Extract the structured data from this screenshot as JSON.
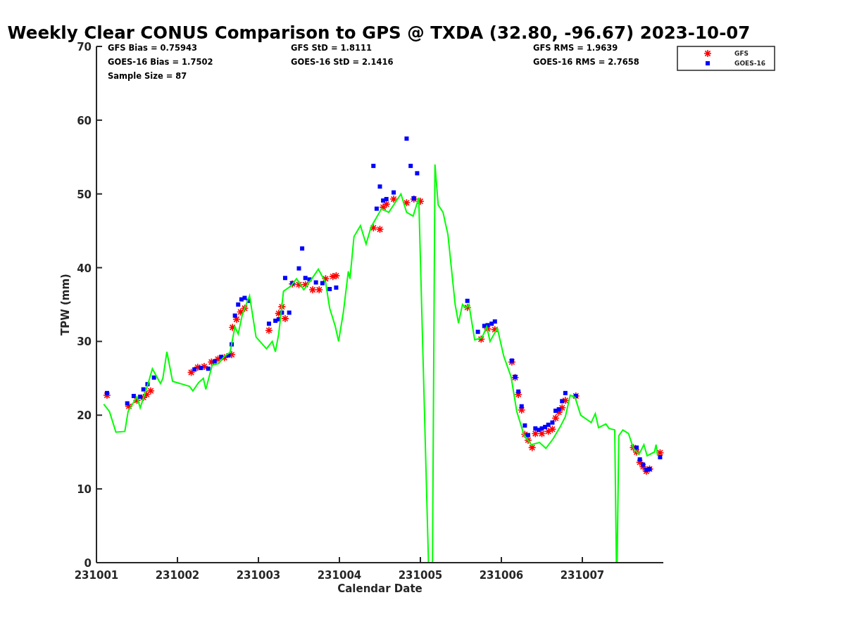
{
  "title": "Weekly Clear CONUS Comparison to GPS @ TXDA (32.80, -96.67) 2023-10-07",
  "stats": [
    [
      "GFS Bias = 0.75943",
      "GFS StD = 1.8111",
      "GFS RMS = 1.9639"
    ],
    [
      "GOES-16 Bias = 1.7502",
      "GOES-16 StD = 2.1416",
      "GOES-16 RMS = 2.7658"
    ],
    [
      "Sample Size = 87"
    ]
  ],
  "chart_data": {
    "type": "scatter",
    "xlabel": "Calendar Date",
    "ylabel": "TPW (mm)",
    "xlim": [
      231001,
      231008
    ],
    "ylim": [
      0,
      70
    ],
    "xticks": [
      231001,
      231002,
      231003,
      231004,
      231005,
      231006,
      231007
    ],
    "yticks": [
      0,
      10,
      20,
      30,
      40,
      50,
      60,
      70
    ],
    "series": [
      {
        "name": "GFS",
        "marker": "cross",
        "color": "#ff0000",
        "x": [
          231001.13,
          231001.4,
          231001.5,
          231001.58,
          231001.62,
          231001.67,
          231002.17,
          231002.25,
          231002.33,
          231002.42,
          231002.5,
          231002.58,
          231002.67,
          231002.68,
          231002.73,
          231002.78,
          231002.83,
          231003.13,
          231003.25,
          231003.29,
          231003.33,
          231003.42,
          231003.5,
          231003.58,
          231003.67,
          231003.75,
          231003.83,
          231003.92,
          231003.96,
          231004.42,
          231004.5,
          231004.54,
          231004.58,
          231004.67,
          231004.83,
          231004.92,
          231005,
          231005.58,
          231005.75,
          231005.83,
          231005.92,
          231006.13,
          231006.17,
          231006.21,
          231006.25,
          231006.29,
          231006.33,
          231006.38,
          231006.42,
          231006.5,
          231006.58,
          231006.63,
          231006.67,
          231006.71,
          231006.75,
          231006.79,
          231006.92,
          231007.63,
          231007.67,
          231007.71,
          231007.75,
          231007.79,
          231007.83,
          231007.96
        ],
        "values": [
          22.7,
          21.2,
          22.0,
          22.4,
          22.8,
          23.3,
          25.8,
          26.5,
          26.6,
          27.2,
          27.6,
          27.8,
          28.2,
          31.9,
          33.0,
          34.0,
          34.5,
          31.5,
          33.8,
          34.7,
          33.1,
          37.8,
          37.7,
          37.7,
          37.0,
          37.0,
          38.5,
          38.8,
          38.9,
          45.4,
          45.2,
          48.2,
          48.6,
          49.3,
          48.8,
          49.3,
          49.0,
          34.6,
          30.3,
          31.7,
          31.6,
          27.2,
          25.1,
          22.8,
          20.7,
          17.4,
          16.6,
          15.6,
          17.5,
          17.5,
          17.8,
          18.1,
          19.6,
          20.4,
          21.0,
          22.0,
          22.6,
          15.6,
          15.0,
          13.6,
          13.0,
          12.4,
          12.7,
          14.9
        ]
      },
      {
        "name": "GOES-16",
        "marker": "square",
        "color": "#0000ff",
        "x": [
          231001.13,
          231001.38,
          231001.46,
          231001.54,
          231001.58,
          231001.63,
          231001.71,
          231002.21,
          231002.29,
          231002.38,
          231002.46,
          231002.54,
          231002.63,
          231002.67,
          231002.71,
          231002.75,
          231002.79,
          231002.83,
          231002.88,
          231003.13,
          231003.21,
          231003.25,
          231003.29,
          231003.33,
          231003.38,
          231003.42,
          231003.5,
          231003.54,
          231003.58,
          231003.63,
          231003.71,
          231003.79,
          231003.88,
          231003.96,
          231004.42,
          231004.46,
          231004.5,
          231004.54,
          231004.58,
          231004.67,
          231004.83,
          231004.88,
          231004.92,
          231004.96,
          231005.58,
          231005.71,
          231005.79,
          231005.83,
          231005.88,
          231005.92,
          231006.13,
          231006.17,
          231006.21,
          231006.25,
          231006.29,
          231006.33,
          231006.42,
          231006.46,
          231006.5,
          231006.54,
          231006.58,
          231006.63,
          231006.67,
          231006.71,
          231006.75,
          231006.79,
          231006.92,
          231007.67,
          231007.71,
          231007.75,
          231007.79,
          231007.83,
          231007.96
        ],
        "values": [
          23.0,
          21.6,
          22.6,
          22.5,
          23.5,
          24.2,
          25.1,
          26.2,
          26.4,
          26.3,
          27.3,
          27.9,
          28.1,
          29.6,
          33.5,
          35.0,
          35.7,
          35.9,
          35.5,
          32.4,
          32.8,
          33.0,
          33.9,
          38.6,
          33.9,
          37.9,
          39.9,
          42.6,
          38.6,
          38.4,
          38.0,
          37.9,
          37.1,
          37.3,
          53.8,
          48.0,
          51.0,
          49.1,
          49.3,
          50.2,
          57.5,
          53.8,
          49.4,
          52.8,
          35.5,
          31.3,
          32.1,
          32.2,
          32.4,
          32.7,
          27.4,
          25.2,
          23.2,
          21.2,
          18.6,
          17.3,
          18.2,
          18.0,
          18.2,
          18.4,
          18.7,
          19.0,
          20.6,
          20.8,
          21.9,
          23.0,
          22.6,
          15.6,
          14.0,
          13.3,
          12.6,
          12.7,
          14.3
        ]
      },
      {
        "type": "line",
        "color": "#00ff00",
        "x": [
          231001.09,
          231001.16,
          231001.24,
          231001.35,
          231001.39,
          231001.5,
          231001.54,
          231001.63,
          231001.69,
          231001.79,
          231001.82,
          231001.87,
          231001.94,
          231002.15,
          231002.19,
          231002.26,
          231002.32,
          231002.35,
          231002.43,
          231002.51,
          231002.58,
          231002.65,
          231002.71,
          231002.75,
          231002.8,
          231002.89,
          231002.97,
          231003.1,
          231003.17,
          231003.21,
          231003.25,
          231003.31,
          231003.4,
          231003.47,
          231003.56,
          231003.66,
          231003.74,
          231003.83,
          231003.88,
          231003.95,
          231003.99,
          231004.05,
          231004.11,
          231004.13,
          231004.18,
          231004.26,
          231004.33,
          231004.39,
          231004.52,
          231004.61,
          231004.76,
          231004.83,
          231004.91,
          231004.98,
          231005.1,
          231005.15,
          231005.18,
          231005.22,
          231005.28,
          231005.31,
          231005.34,
          231005.43,
          231005.47,
          231005.52,
          231005.56,
          231005.6,
          231005.67,
          231005.76,
          231005.82,
          231005.86,
          231005.95,
          231006.03,
          231006.12,
          231006.19,
          231006.28,
          231006.37,
          231006.47,
          231006.55,
          231006.64,
          231006.73,
          231006.79,
          231006.85,
          231006.91,
          231006.98,
          231007.11,
          231007.16,
          231007.2,
          231007.29,
          231007.33,
          231007.4,
          231007.42,
          231007.43,
          231007.45,
          231007.5,
          231007.57,
          231007.63,
          231007.7,
          231007.76,
          231007.8,
          231007.89,
          231007.91,
          231007.93
        ],
        "values": [
          21.5,
          20.5,
          17.7,
          17.8,
          20.5,
          22.5,
          21.0,
          24.0,
          26.3,
          24.3,
          25.0,
          28.6,
          24.6,
          23.9,
          23.3,
          24.4,
          25.0,
          23.5,
          26.8,
          27.0,
          28.0,
          28.5,
          32.0,
          31.0,
          33.6,
          36.2,
          30.6,
          29.0,
          30.0,
          28.6,
          31.0,
          36.8,
          37.5,
          38.5,
          37.0,
          38.5,
          39.8,
          38.0,
          34.5,
          32.0,
          30.0,
          34.0,
          39.5,
          38.5,
          44.2,
          45.7,
          43.2,
          45.5,
          48.0,
          47.5,
          50.0,
          47.5,
          47.0,
          49.5,
          0,
          0,
          54.0,
          48.5,
          47.5,
          46.0,
          44.5,
          35.0,
          32.5,
          35.0,
          34.5,
          35.0,
          30.2,
          30.5,
          32.0,
          30.0,
          31.8,
          28.0,
          25.2,
          20.5,
          17.3,
          16.0,
          16.3,
          15.5,
          16.8,
          18.5,
          19.8,
          22.7,
          22.4,
          20.0,
          19.0,
          20.2,
          18.3,
          18.8,
          18.2,
          18.0,
          0,
          0,
          17.2,
          18.0,
          17.5,
          15.5,
          14.7,
          16.0,
          14.5,
          15.0,
          16.0,
          14.5
        ]
      }
    ]
  }
}
